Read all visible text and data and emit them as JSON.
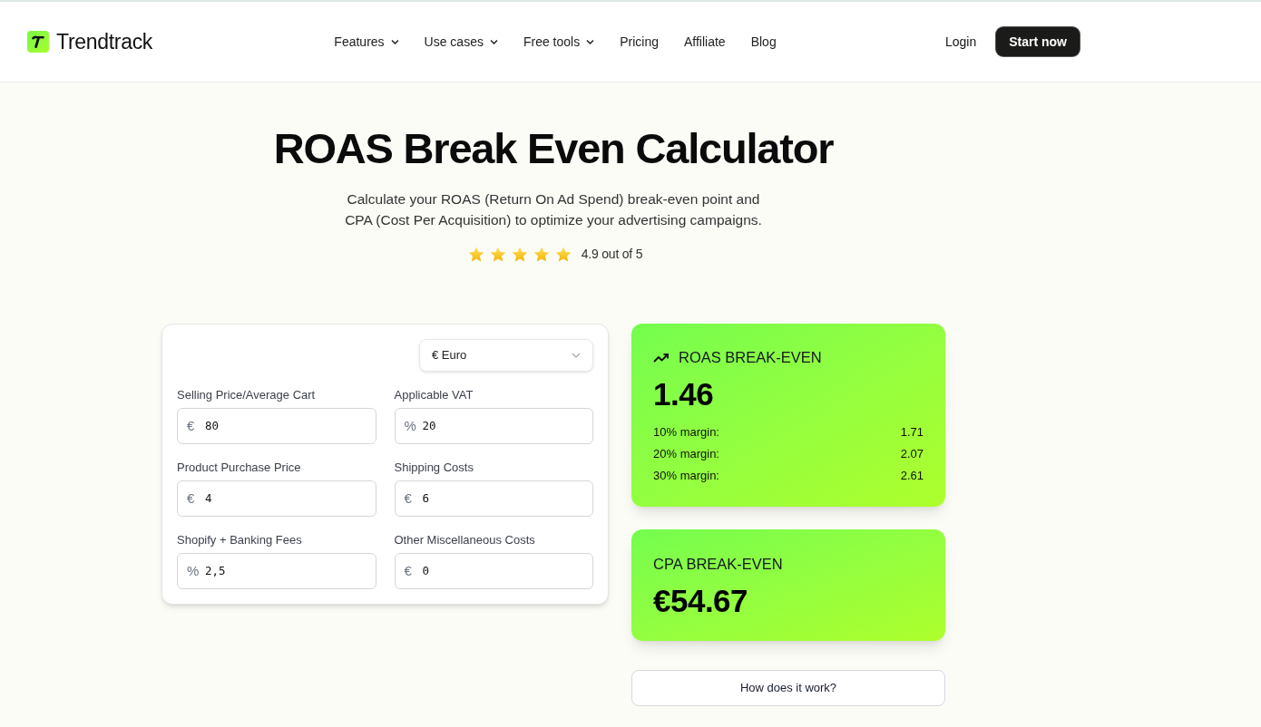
{
  "header": {
    "logo": {
      "text": "Trendtrack"
    },
    "nav": [
      {
        "label": "Features",
        "dropdown": true
      },
      {
        "label": "Use cases",
        "dropdown": true
      },
      {
        "label": "Free tools",
        "dropdown": true
      },
      {
        "label": "Pricing",
        "dropdown": false
      },
      {
        "label": "Affiliate",
        "dropdown": false
      },
      {
        "label": "Blog",
        "dropdown": false
      }
    ],
    "login": "Login",
    "cta": "Start now"
  },
  "hero": {
    "title": "ROAS Break Even Calculator",
    "subtitle": "Calculate your ROAS (Return On Ad Spend) break-even point and CPA (Cost Per Acquisition) to optimize your advertising campaigns.",
    "rating": {
      "stars": 5,
      "text": "4.9 out of 5"
    }
  },
  "calculator": {
    "currency": {
      "value": "€ Euro"
    },
    "fields": [
      {
        "label": "Selling Price/Average Cart",
        "prefix": "€",
        "value": "80"
      },
      {
        "label": "Applicable VAT",
        "prefix": "%",
        "value": "20"
      },
      {
        "label": "Product Purchase Price",
        "prefix": "€",
        "value": "4"
      },
      {
        "label": "Shipping Costs",
        "prefix": "€",
        "value": "6"
      },
      {
        "label": "Shopify + Banking Fees",
        "prefix": "%",
        "value": "2,5"
      },
      {
        "label": "Other Miscellaneous Costs",
        "prefix": "€",
        "value": "0"
      }
    ]
  },
  "results": [
    {
      "kind": "roas",
      "title": "ROAS BREAK-EVEN",
      "value": "1.46",
      "margins": [
        {
          "label": "10% margin:",
          "value": "1.71"
        },
        {
          "label": "20% margin:",
          "value": "2.07"
        },
        {
          "label": "30% margin:",
          "value": "2.61"
        }
      ]
    },
    {
      "kind": "cpa",
      "title": "CPA BREAK-EVEN",
      "value": "€54.67"
    }
  ],
  "help_button": "How does it work?"
}
